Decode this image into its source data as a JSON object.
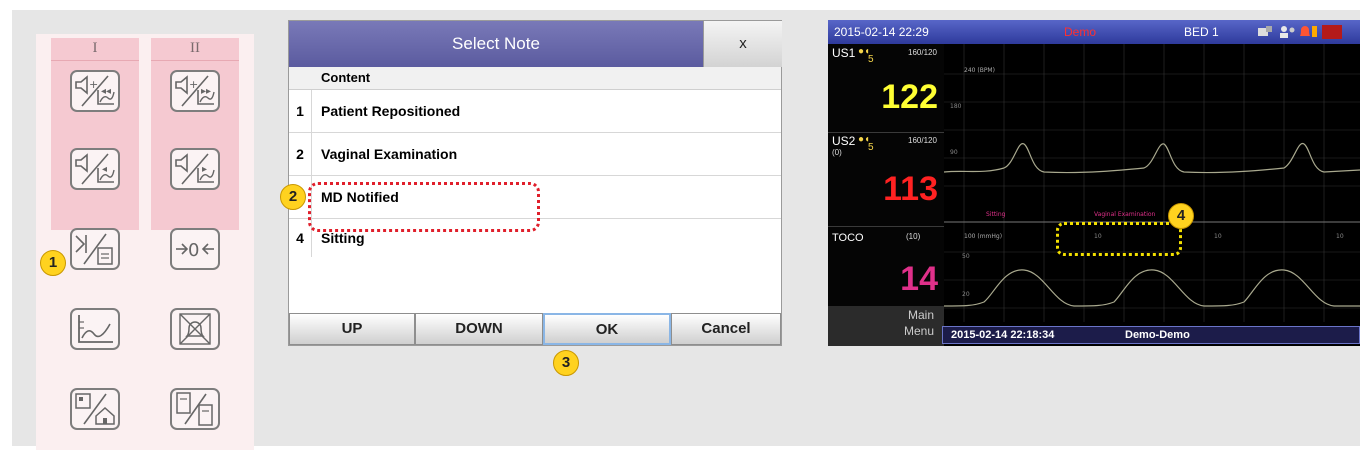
{
  "key_panel": {
    "columns": [
      "I",
      "II"
    ]
  },
  "markers": [
    "1",
    "2",
    "3",
    "4"
  ],
  "dialog": {
    "title": "Select Note",
    "close_label": "x",
    "column_header": "Content",
    "rows": [
      {
        "num": "1",
        "label": "Patient Repositioned"
      },
      {
        "num": "2",
        "label": "Vaginal Examination"
      },
      {
        "num": "",
        "label": "MD Notified"
      },
      {
        "num": "4",
        "label": "Sitting"
      }
    ],
    "buttons": {
      "up": "UP",
      "down": "DOWN",
      "ok": "OK",
      "cancel": "Cancel"
    }
  },
  "monitor": {
    "datetime": "2015-02-14  22:29",
    "mode": "Demo",
    "bed": "BED 1",
    "us1_label": "US1",
    "us1_sub": "5",
    "us1_range": "160/120",
    "us1_value": "122",
    "us2_label": "US2",
    "us2_sub": "5",
    "us2_zero": "(0)",
    "us2_range": "160/120",
    "us2_value": "113",
    "toco_label": "TOCO",
    "toco_zero": "(10)",
    "toco_value": "14",
    "menu_line1": "Main",
    "menu_line2": "Menu",
    "chart_fhr_label": "240 (BPM)",
    "chart_fhr_ticks": [
      "180",
      "90"
    ],
    "chart_note_1": "Sitting",
    "chart_note_2": "Vaginal Examination",
    "chart_toco_label": "100 (mmHg)",
    "chart_toco_ticks": [
      "50",
      "20"
    ],
    "chart_time_labels": [
      "10",
      "10",
      "10"
    ],
    "bottom_time": "2015-02-14 22:18:34",
    "bottom_name": "Demo-Demo",
    "colors": {
      "us1": "#ffff33",
      "us2": "#ff2222",
      "toco": "#e0308a",
      "trace": "#a9a98e"
    }
  }
}
